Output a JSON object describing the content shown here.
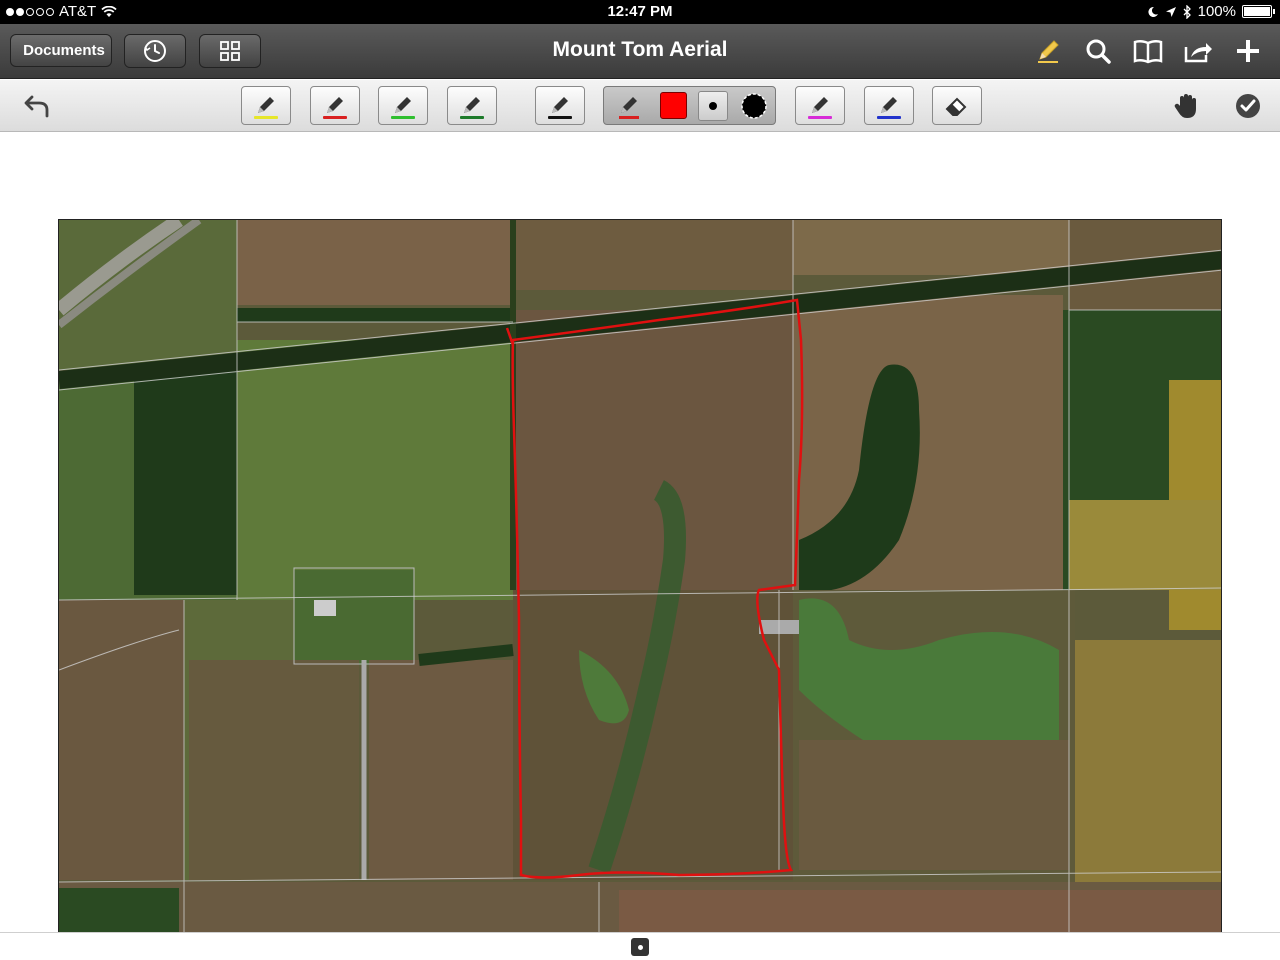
{
  "status_bar": {
    "carrier": "AT&T",
    "time": "12:47 PM",
    "battery": "100%"
  },
  "nav": {
    "back_label": "Documents",
    "title": "Mount Tom Aerial"
  },
  "icons": {
    "back": "chevron-left-icon",
    "history": "clock-icon",
    "thumbnails": "grid-icon",
    "annotate": "pencil-icon",
    "search": "search-icon",
    "bookmarks": "book-icon",
    "share": "share-icon",
    "add": "plus-icon",
    "undo": "undo-icon",
    "pan": "hand-icon",
    "done": "checkmark-icon",
    "eraser": "eraser-icon"
  },
  "tools": {
    "pens": [
      {
        "name": "highlighter-yellow",
        "color": "#e6e62a"
      },
      {
        "name": "pen-red",
        "color": "#d92020"
      },
      {
        "name": "pen-green",
        "color": "#2fbf2f"
      },
      {
        "name": "pen-dark-green",
        "color": "#1d7a2a"
      },
      {
        "name": "pen-black",
        "color": "#111111"
      }
    ],
    "active_pen_color": "#d92020",
    "active_swatch": "#ff0000",
    "after_group": [
      {
        "name": "pen-magenta",
        "color": "#d72bd7"
      },
      {
        "name": "pen-blue",
        "color": "#2233cc"
      }
    ]
  },
  "colors": {
    "nav_bg": "#4a4a4a",
    "outline": "#e01010",
    "field_brown": "#6b5a40",
    "field_green": "#5a7a3a",
    "tree_dark": "#1f3a1a"
  }
}
